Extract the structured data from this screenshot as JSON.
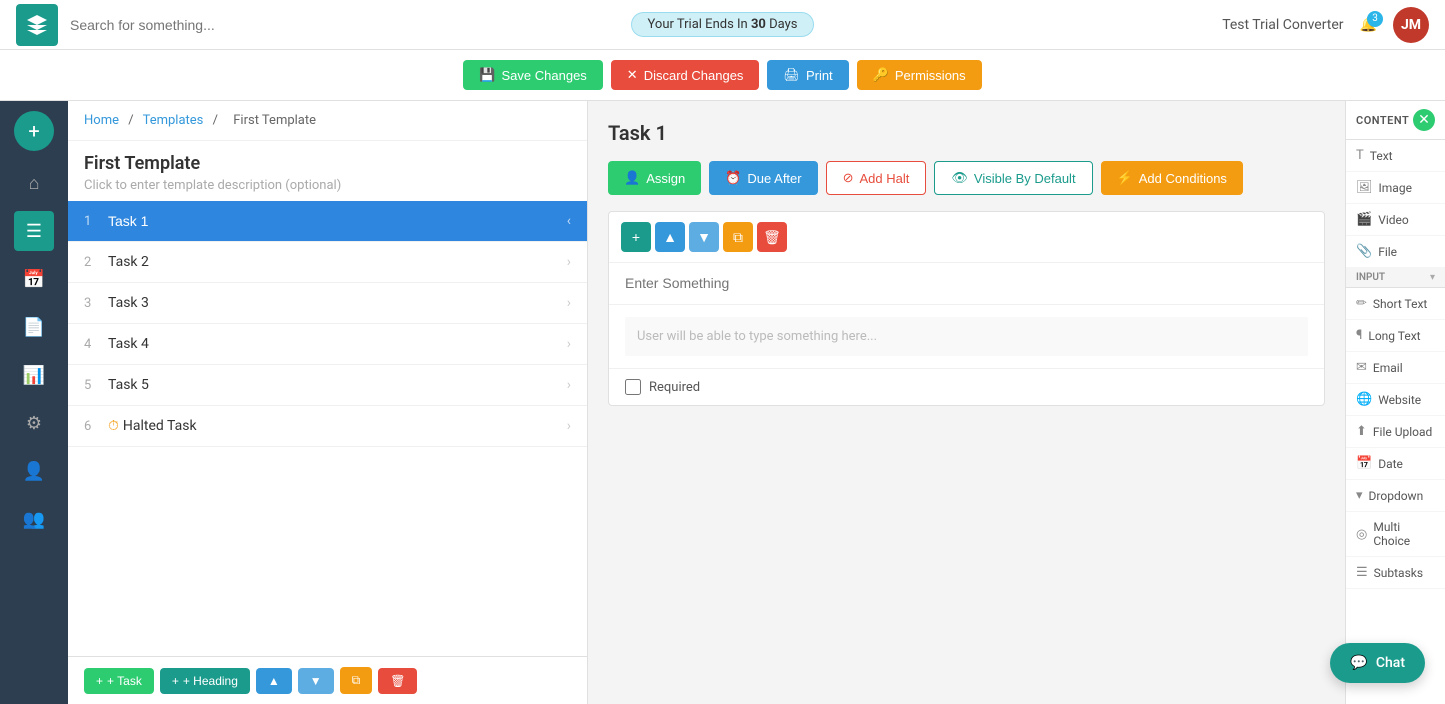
{
  "topbar": {
    "search_placeholder": "Search for something...",
    "trial_text": "Your Trial Ends In ",
    "trial_days": "30",
    "trial_suffix": " Days",
    "workspace": "Test Trial Converter",
    "notification_count": "3",
    "avatar_initials": "JM"
  },
  "actionbar": {
    "save_label": "Save Changes",
    "discard_label": "Discard Changes",
    "print_label": "Print",
    "permissions_label": "Permissions"
  },
  "sidebar": {
    "items": [
      {
        "name": "add",
        "icon": "+"
      },
      {
        "name": "home",
        "icon": "⌂"
      },
      {
        "name": "list",
        "icon": "☰"
      },
      {
        "name": "calendar",
        "icon": "📅"
      },
      {
        "name": "document",
        "icon": "📄"
      },
      {
        "name": "chart",
        "icon": "📊"
      },
      {
        "name": "settings",
        "icon": "⚙"
      },
      {
        "name": "user",
        "icon": "👤"
      },
      {
        "name": "team",
        "icon": "👥"
      }
    ]
  },
  "breadcrumb": {
    "home": "Home",
    "templates": "Templates",
    "current": "First Template"
  },
  "template": {
    "title": "First Template",
    "description": "Click to enter template description (optional)"
  },
  "tasks": [
    {
      "num": "1",
      "name": "Task 1",
      "active": true
    },
    {
      "num": "2",
      "name": "Task 2",
      "active": false
    },
    {
      "num": "3",
      "name": "Task 3",
      "active": false
    },
    {
      "num": "4",
      "name": "Task 4",
      "active": false
    },
    {
      "num": "5",
      "name": "Task 5",
      "active": false
    },
    {
      "num": "6",
      "name": "Halted Task",
      "active": false,
      "halted": true
    }
  ],
  "taskbar": {
    "add_task": "+ Task",
    "add_heading": "+ Heading"
  },
  "main": {
    "task_title": "Task 1",
    "assign_label": "Assign",
    "due_after_label": "Due After",
    "add_halt_label": "Add Halt",
    "visible_by_default_label": "Visible By Default",
    "add_conditions_label": "Add Conditions",
    "field_placeholder": "Enter Something",
    "input_placeholder": "User will be able to type something here...",
    "required_label": "Required"
  },
  "right_panel": {
    "title": "CONTENT",
    "items": [
      {
        "icon": "T",
        "label": "Text"
      },
      {
        "icon": "🖼",
        "label": "Image"
      },
      {
        "icon": "🎬",
        "label": "Video"
      },
      {
        "icon": "📎",
        "label": "File"
      }
    ],
    "input_section": "INPUT",
    "input_items": [
      {
        "icon": "✏",
        "label": "Short Text"
      },
      {
        "icon": "¶",
        "label": "Long Text"
      },
      {
        "icon": "✉",
        "label": "Email"
      },
      {
        "icon": "🌐",
        "label": "Website"
      },
      {
        "icon": "⬆",
        "label": "File Upload"
      },
      {
        "icon": "📅",
        "label": "Date"
      },
      {
        "icon": "▾",
        "label": "Dropdown"
      },
      {
        "icon": "◎",
        "label": "Multi Choice"
      },
      {
        "icon": "☰",
        "label": "Subtasks"
      }
    ]
  },
  "chat": {
    "label": "Chat"
  }
}
